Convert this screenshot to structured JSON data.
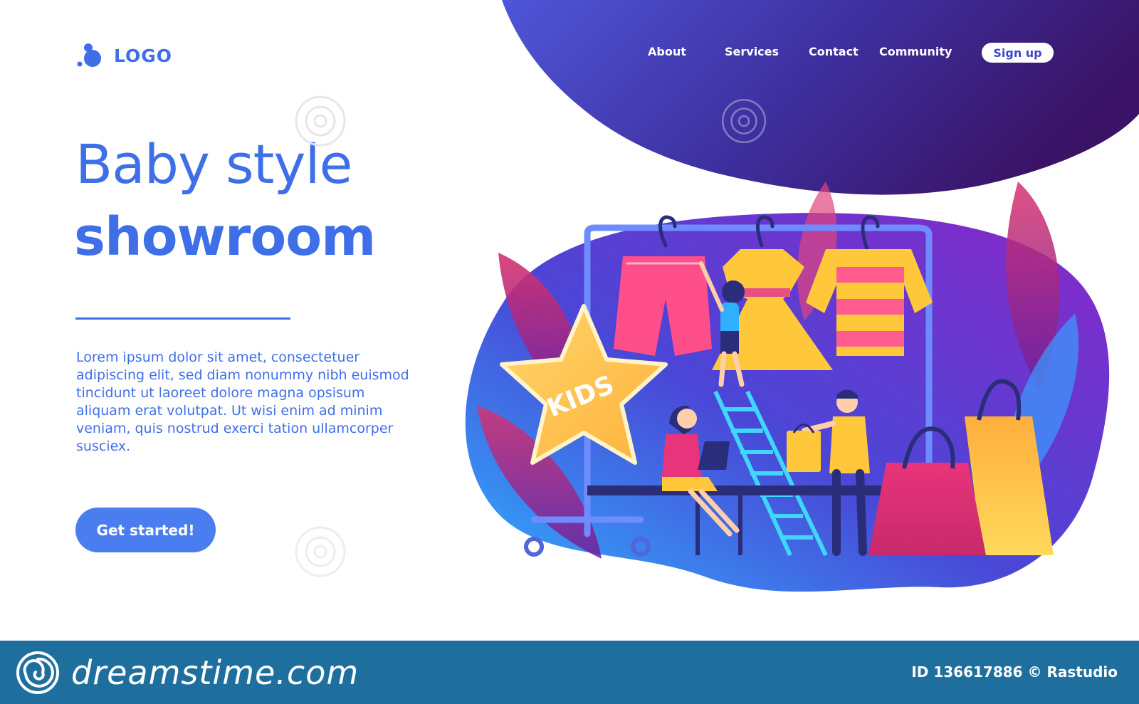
{
  "logo": {
    "text": "LOGO",
    "icon": "logo-dot-mark"
  },
  "nav": {
    "links": [
      "About",
      "Services",
      "Contact",
      "Community"
    ],
    "signup_label": "Sign up"
  },
  "hero": {
    "line1": "Baby style",
    "line2": "showroom",
    "body": "Lorem ipsum dolor sit amet, consectetuer adipiscing elit, sed diam nonummy nibh euismod tincidunt ut laoreet dolore magna opsisum aliquam erat volutpat. Ut wisi enim ad minim veniam, quis nostrud exerci tation ullamcorper susciex.",
    "cta_label": "Get started!"
  },
  "illustration": {
    "star_label": "KIDS"
  },
  "watermark": {
    "text": "dreamstime"
  },
  "footer": {
    "brand": "dreamstime.com",
    "id_text": "ID 136617886 © Rastudio"
  },
  "colors": {
    "accent": "#3f6fe8",
    "blob_dark": "#3b1c7a",
    "blob_mid": "#4a3fc0",
    "footer": "#1f6f9e"
  }
}
